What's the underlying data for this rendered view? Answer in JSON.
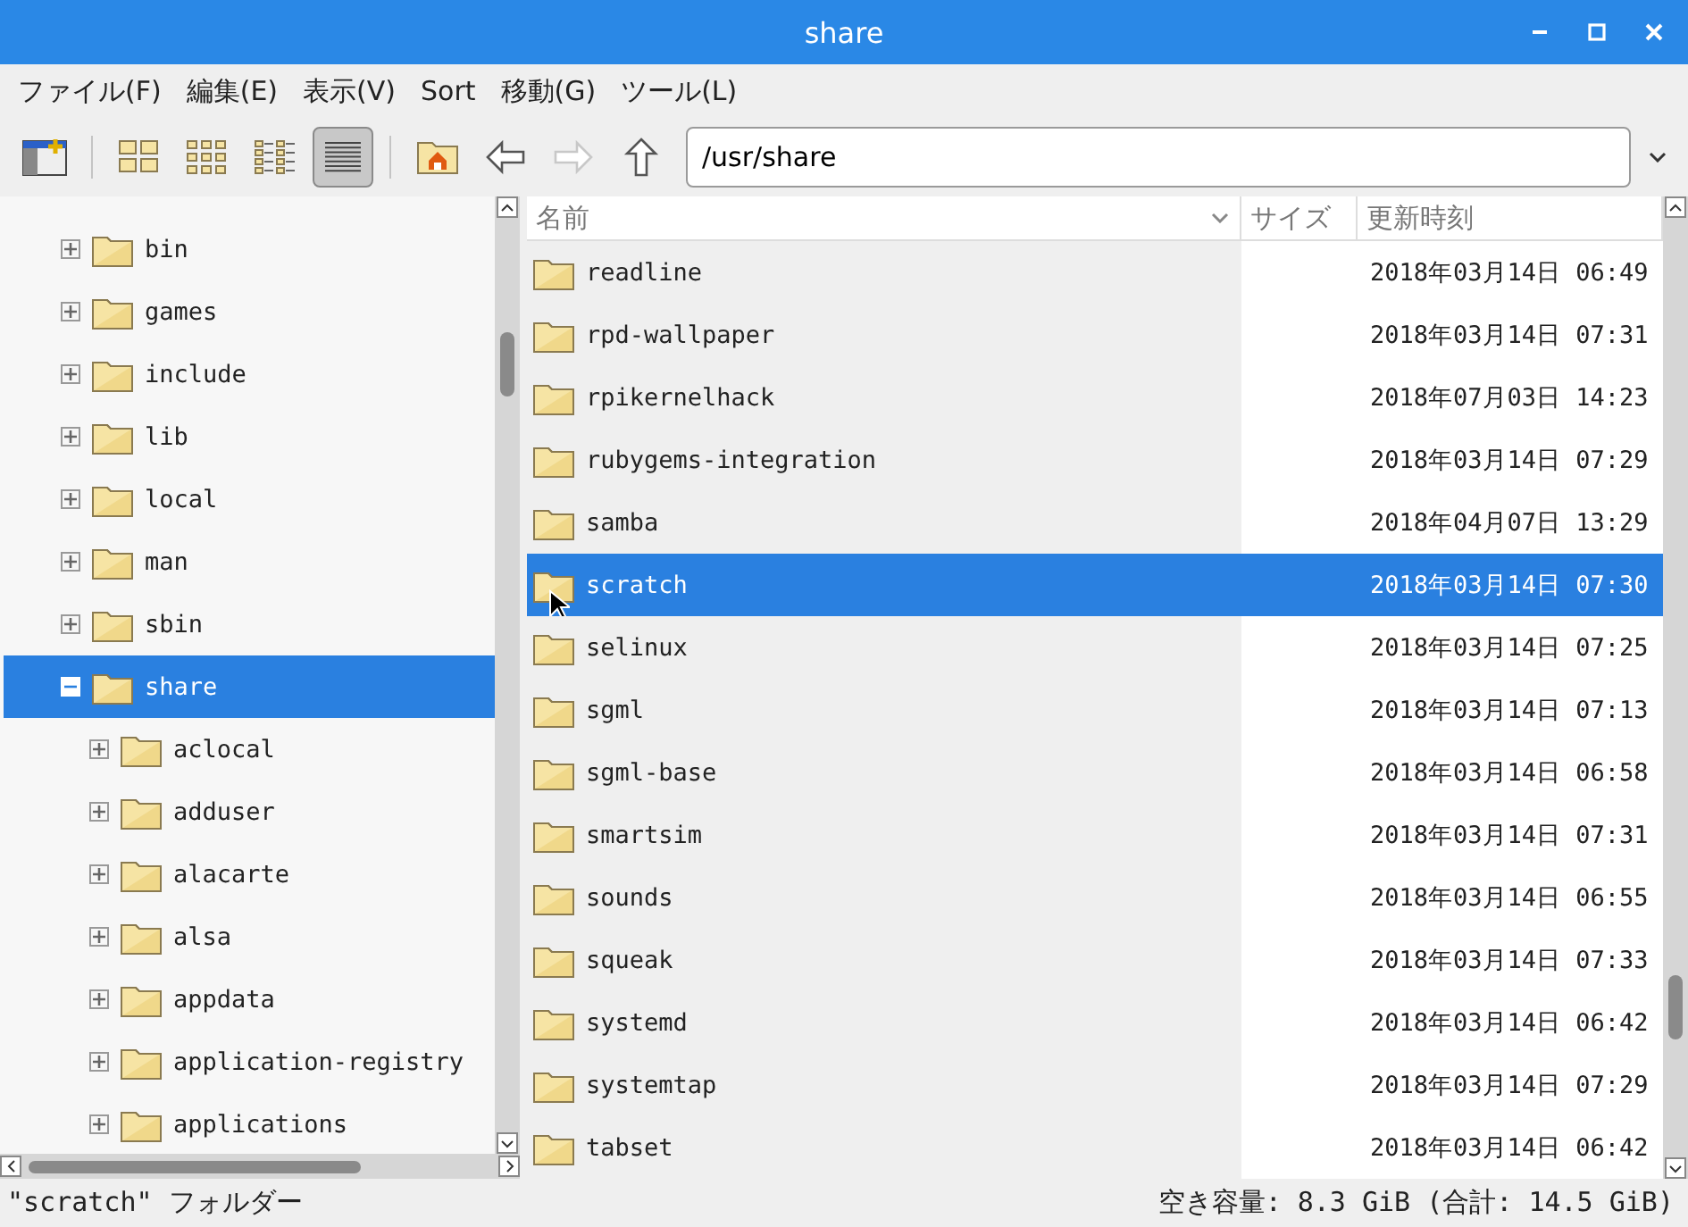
{
  "window": {
    "title": "share"
  },
  "menu": [
    "ファイル(F)",
    "編集(E)",
    "表示(V)",
    "Sort",
    "移動(G)",
    "ツール(L)"
  ],
  "toolbar": {
    "views": [
      {
        "kind": "icons",
        "selected": false
      },
      {
        "kind": "thumbs",
        "selected": false
      },
      {
        "kind": "compact",
        "selected": false
      },
      {
        "kind": "list",
        "selected": true
      }
    ],
    "forward_disabled": true,
    "path": "/usr/share"
  },
  "tree": [
    {
      "name": "bin",
      "expanded": false,
      "selected": false
    },
    {
      "name": "games",
      "expanded": false,
      "selected": false
    },
    {
      "name": "include",
      "expanded": false,
      "selected": false
    },
    {
      "name": "lib",
      "expanded": false,
      "selected": false
    },
    {
      "name": "local",
      "expanded": false,
      "selected": false
    },
    {
      "name": "man",
      "expanded": false,
      "selected": false
    },
    {
      "name": "sbin",
      "expanded": false,
      "selected": false
    },
    {
      "name": "share",
      "expanded": true,
      "selected": true,
      "children": [
        {
          "name": "aclocal",
          "expanded": false,
          "selected": false
        },
        {
          "name": "adduser",
          "expanded": false,
          "selected": false
        },
        {
          "name": "alacarte",
          "expanded": false,
          "selected": false
        },
        {
          "name": "alsa",
          "expanded": false,
          "selected": false
        },
        {
          "name": "appdata",
          "expanded": false,
          "selected": false
        },
        {
          "name": "application-registry",
          "expanded": false,
          "selected": false
        },
        {
          "name": "applications",
          "expanded": false,
          "selected": false
        }
      ]
    }
  ],
  "table": {
    "columns": [
      "名前",
      "サイズ",
      "更新時刻"
    ],
    "rows": [
      {
        "name": "readline",
        "modified": "2018年03月14日 06:49",
        "selected": false
      },
      {
        "name": "rpd-wallpaper",
        "modified": "2018年03月14日 07:31",
        "selected": false
      },
      {
        "name": "rpikernelhack",
        "modified": "2018年07月03日 14:23",
        "selected": false
      },
      {
        "name": "rubygems-integration",
        "modified": "2018年03月14日 07:29",
        "selected": false
      },
      {
        "name": "samba",
        "modified": "2018年04月07日 13:29",
        "selected": false
      },
      {
        "name": "scratch",
        "modified": "2018年03月14日 07:30",
        "selected": true
      },
      {
        "name": "selinux",
        "modified": "2018年03月14日 07:25",
        "selected": false
      },
      {
        "name": "sgml",
        "modified": "2018年03月14日 07:13",
        "selected": false
      },
      {
        "name": "sgml-base",
        "modified": "2018年03月14日 06:58",
        "selected": false
      },
      {
        "name": "smartsim",
        "modified": "2018年03月14日 07:31",
        "selected": false
      },
      {
        "name": "sounds",
        "modified": "2018年03月14日 06:55",
        "selected": false
      },
      {
        "name": "squeak",
        "modified": "2018年03月14日 07:33",
        "selected": false
      },
      {
        "name": "systemd",
        "modified": "2018年03月14日 06:42",
        "selected": false
      },
      {
        "name": "systemtap",
        "modified": "2018年03月14日 07:29",
        "selected": false
      },
      {
        "name": "tabset",
        "modified": "2018年03月14日 06:42",
        "selected": false
      }
    ]
  },
  "status_bar": {
    "left": "\"scratch\" フォルダー",
    "right": "空き容量: 8.3 GiB (合計: 14.5 GiB)"
  }
}
